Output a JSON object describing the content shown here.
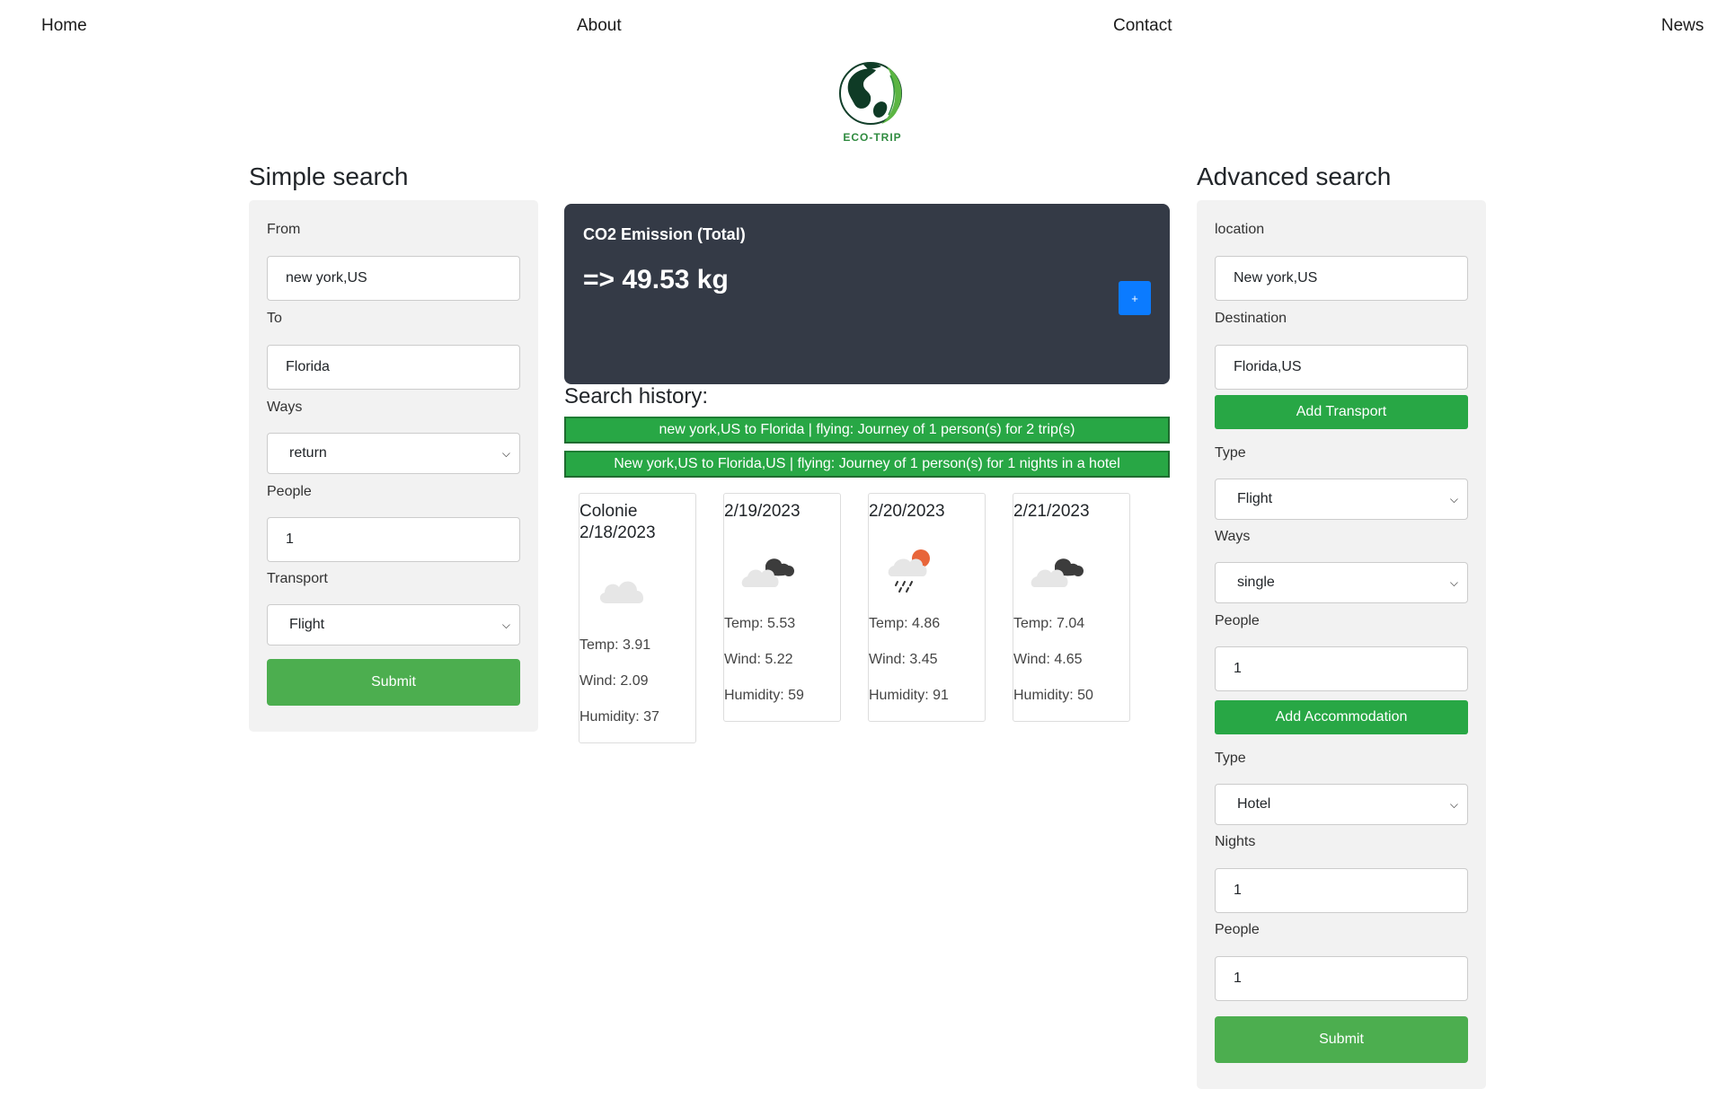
{
  "nav": {
    "home": "Home",
    "about": "About",
    "contact": "Contact",
    "news": "News"
  },
  "logo": {
    "text": "ECO-TRIP"
  },
  "simple": {
    "heading": "Simple search",
    "from_label": "From",
    "from_value": "new york,US",
    "to_label": "To",
    "to_value": "Florida",
    "ways_label": "Ways",
    "ways_value": "return",
    "people_label": "People",
    "people_value": "1",
    "transport_label": "Transport",
    "transport_value": "Flight",
    "submit": "Submit"
  },
  "co2": {
    "title": "CO2 Emission (Total)",
    "value": "=> 49.53 kg",
    "plus": "+"
  },
  "history": {
    "title": "Search history:",
    "items": [
      "new york,US to Florida | flying: Journey of 1 person(s) for 2 trip(s)",
      "New york,US to Florida,US | flying: Journey of 1 person(s) for 1 nights in a hotel"
    ]
  },
  "weather": [
    {
      "title_line1": "Colonie",
      "title_line2": "2/18/2023",
      "icon": "cloud-icon",
      "temp": "Temp: 3.91",
      "wind": "Wind: 2.09",
      "humidity": "Humidity: 37"
    },
    {
      "title_line1": "2/19/2023",
      "title_line2": "",
      "icon": "broken-clouds-icon",
      "temp": "Temp: 5.53",
      "wind": "Wind: 5.22",
      "humidity": "Humidity: 59"
    },
    {
      "title_line1": "2/20/2023",
      "title_line2": "",
      "icon": "rain-sun-icon",
      "temp": "Temp: 4.86",
      "wind": "Wind: 3.45",
      "humidity": "Humidity: 91"
    },
    {
      "title_line1": "2/21/2023",
      "title_line2": "",
      "icon": "broken-clouds-icon",
      "temp": "Temp: 7.04",
      "wind": "Wind: 4.65",
      "humidity": "Humidity: 50"
    }
  ],
  "advanced": {
    "heading": "Advanced search",
    "location_label": "location",
    "location_value": "New york,US",
    "destination_label": "Destination",
    "destination_value": "Florida,US",
    "add_transport": "Add Transport",
    "type_label": "Type",
    "type_value": "Flight",
    "ways_label": "Ways",
    "ways_value": "single",
    "people_label": "People",
    "people_value": "1",
    "add_accommodation": "Add Accommodation",
    "acc_type_label": "Type",
    "acc_type_value": "Hotel",
    "nights_label": "Nights",
    "nights_value": "1",
    "acc_people_label": "People",
    "acc_people_value": "1",
    "submit": "Submit"
  },
  "colors": {
    "green_button": "#4cae4f",
    "history_green": "#28a745",
    "co2_bg": "#343a46",
    "plus_blue": "#0b7bff",
    "panel_bg": "#f2f2f2"
  }
}
